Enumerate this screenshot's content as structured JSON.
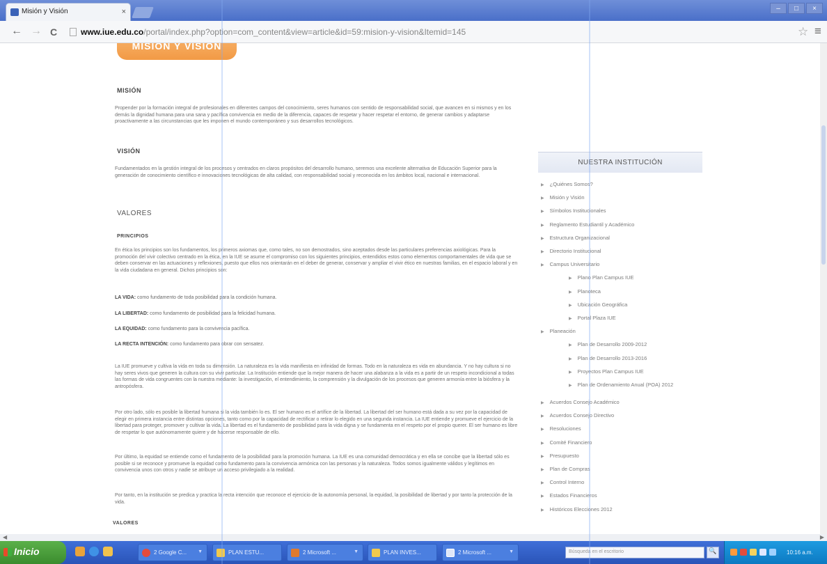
{
  "browser": {
    "tab_title": "Misión y Visión",
    "tab_close": "×",
    "url_host": "www.iue.edu.co",
    "url_path": "/portal/index.php?option=com_content&view=article&id=59:mision-y-vision&Itemid=145",
    "nav": {
      "back": "←",
      "forward": "→",
      "reload": "C"
    },
    "star": "☆",
    "menu": "≡",
    "window_controls": [
      "–",
      "□",
      "×"
    ]
  },
  "page": {
    "banner_title": "MISIÓN Y VISIÓN",
    "mision_heading": "MISIÓN",
    "mision_text": "Propender por la formación integral de profesionales en diferentes campos del conocimiento, seres humanos con sentido de responsabilidad social, que avancen en si mismos y en los demás la dignidad humana para una sana y pacífica convivencia en medio de la diferencia, capaces de respetar y hacer respetar el entorno, de generar cambios y adaptarse proactivamente a las circunstancias que les imponen el mundo contemporáneo y sus desarrollos tecnológicos.",
    "vision_heading": "VISIÓN",
    "vision_text": "Fundamentados en la gestión integral de los procesos y centrados en claros propósitos del desarrollo humano, seremos una excelente alternativa de Educación Superior para la generación de conocimiento científico e innovaciones tecnológicas de alta calidad, con responsabilidad social y reconocida en los ámbitos local, nacional e internacional.",
    "valores_heading": "VALORES",
    "principios_heading": "PRINCIPIOS",
    "principios_text": "En ética los principios son los fundamentos, los primeros axiomas que, como tales, no son demostrados, sino aceptados desde las particulares preferencias axiológicas. Para la promoción del vivir colectivo centrado en la ética, en la IUE se asume el compromiso con los siguientes principios, entendidos estos como elementos comportamentales de vida que se deben conservar en las actuaciones y reflexiones, puesto que ellos nos orientarán en el deber de generar, conservar y ampliar el vivir ético en nuestras familias, en el espacio laboral y en la vida ciudadana en general. Dichos principios son:",
    "principles": [
      {
        "name": "LA VIDA:",
        "desc": " como fundamento de toda posibilidad para la condición humana."
      },
      {
        "name": "LA LIBERTAD:",
        "desc": " como fundamento de posibilidad para la felicidad humana."
      },
      {
        "name": "LA EQUIDAD:",
        "desc": " como fundamento para la convivencia pacífica."
      },
      {
        "name": "LA RECTA INTENCIÓN:",
        "desc": " como fundamento para obrar con sensatez."
      }
    ],
    "paragraph_vida": "La IUE promueve y cultiva la vida en toda su dimensión. La naturaleza es la vida manifiesta en infinidad de formas. Todo en la naturaleza es vida en abundancia. Y no hay cultura si no hay seres vivos que generen la cultura con su vivir particular. La Institución entiende que la mejor manera de hacer una alabanza a la vida es a partir de un respeto incondicional a todas las formas de vida congruentes con la nuestra mediante: la investigación, el entendimiento, la comprensión y la divulgación de los procesos que generen armonía entre la biósfera y la antropósfera.",
    "paragraph_libertad": "Por otro lado, sólo es posible la libertad humana si la vida también lo es. El ser humano es el artífice de la libertad. La libertad del ser humano está dada a su vez por la capacidad de elegir en primera instancia entre distintas opciones, tanto como por la capacidad de rectificar o retirar lo elegido en una segunda instancia. La IUE entiende y promueve el ejercicio de la libertad para proteger, promover y cultivar la vida. La libertad es el fundamento de posibilidad para la vida digna y se fundamenta en el respeto por el propio querer. El ser humano es libre de respetar lo que autónomamente quiere y de hacerse responsable de ello.",
    "paragraph_equidad": "Por último, la equidad se entiende como el fundamento de la posibilidad para la promoción humana. La IUE es una comunidad democrática y en ella se concibe que la libertad sólo es posible si se reconoce y promueve la equidad como fundamento para la convivencia armónica con las personas y la naturaleza. Todos somos igualmente válidos y legítimos en convivencia unos con otros y nadie se atribuye un acceso privilegiado a la realidad.",
    "paragraph_recta": "Por tanto, en la institución se predica y practica la recta intención que reconoce el ejercicio de la autonomía personal, la equidad, la posibilidad de libertad y por tanto la protección de la vida.",
    "valores_heading_bottom": "VALORES"
  },
  "sidebar": {
    "title": "NUESTRA INSTITUCIÓN",
    "items": [
      {
        "label": "¿Quiénes Somos?",
        "sub": false
      },
      {
        "label": "Misión y Visión",
        "sub": false
      },
      {
        "label": "Símbolos Institucionales",
        "sub": false
      },
      {
        "label": "Reglamento Estudiantil y Académico",
        "sub": false
      },
      {
        "label": "Estructura Organizacional",
        "sub": false
      },
      {
        "label": "Directorio Institucional",
        "sub": false
      },
      {
        "label": "Campus Universitario",
        "sub": false
      },
      {
        "label": "Plano Plan Campus IUE",
        "sub": true
      },
      {
        "label": "Planoteca",
        "sub": true
      },
      {
        "label": "Ubicación Geográfica",
        "sub": true
      },
      {
        "label": "Portal Plaza IUE",
        "sub": true
      },
      {
        "label": "Planeación",
        "sub": false
      },
      {
        "label": "Plan de Desarrollo 2009-2012",
        "sub": true
      },
      {
        "label": "Plan de Desarrollo 2013-2016",
        "sub": true
      },
      {
        "label": "Proyectos Plan Campus IUE",
        "sub": true
      },
      {
        "label": "Plan de Ordenamiento Anual (POA) 2012",
        "sub": true
      },
      {
        "label": "Acuerdos Consejo Académico",
        "sub": false
      },
      {
        "label": "Acuerdos Consejo Directivo",
        "sub": false
      },
      {
        "label": "Resoluciones",
        "sub": false
      },
      {
        "label": "Comité Financiero",
        "sub": false
      },
      {
        "label": "Presupuesto",
        "sub": false
      },
      {
        "label": "Plan de Compras",
        "sub": false
      },
      {
        "label": "Control Interno",
        "sub": false
      },
      {
        "label": "Estados Financieros",
        "sub": false
      },
      {
        "label": "Históricos Elecciones 2012",
        "sub": false
      }
    ]
  },
  "taskbar": {
    "start_label": "Inicio",
    "buttons": [
      {
        "label": "2 Google C..."
      },
      {
        "label": "PLAN ESTU..."
      },
      {
        "label": "2 Microsoft ..."
      },
      {
        "label": "PLAN INVES..."
      },
      {
        "label": "2 Microsoft ..."
      }
    ],
    "search_placeholder": "Búsqueda en el escritorio",
    "search_button": "🔍",
    "clock": "10:16 a.m."
  }
}
